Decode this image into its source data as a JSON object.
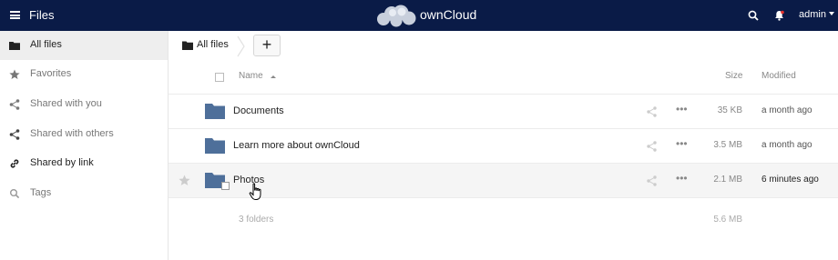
{
  "header": {
    "app_title": "Files",
    "brand": "ownCloud",
    "user": "admin",
    "bg_color": "#0a1b47"
  },
  "sidebar": {
    "items": [
      {
        "label": "All files",
        "icon": "folder-icon",
        "active": true
      },
      {
        "label": "Favorites",
        "icon": "star-icon"
      },
      {
        "label": "Shared with you",
        "icon": "share-icon"
      },
      {
        "label": "Shared with others",
        "icon": "share-icon"
      },
      {
        "label": "Shared by link",
        "icon": "link-icon"
      },
      {
        "label": "Tags",
        "icon": "tag-icon"
      }
    ]
  },
  "breadcrumb": {
    "label": "All files",
    "new_label": "+"
  },
  "table": {
    "columns": {
      "name": "Name",
      "size": "Size",
      "modified": "Modified"
    },
    "rows": [
      {
        "name": "Documents",
        "size": "35 KB",
        "modified": "a month ago"
      },
      {
        "name": "Learn more about ownCloud",
        "size": "3.5 MB",
        "modified": "a month ago"
      },
      {
        "name": "Photos",
        "size": "2.1 MB",
        "modified": "6 minutes ago"
      }
    ],
    "summary": {
      "label": "3 folders",
      "size": "5.6 MB"
    }
  },
  "colors": {
    "folder": "#4e6f9a",
    "active_bg": "#eeeeee"
  }
}
